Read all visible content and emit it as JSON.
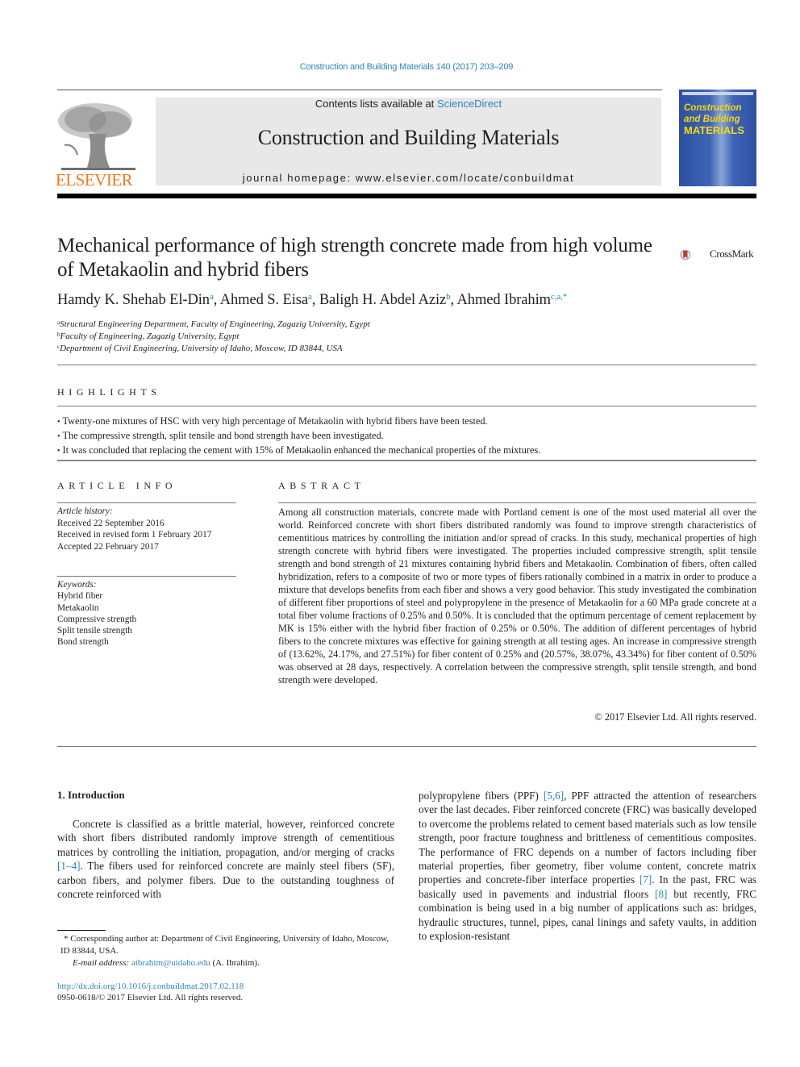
{
  "header": {
    "journal_reference": "Construction and Building Materials 140 (2017) 203–209",
    "contents_prefix": "Contents lists available at ",
    "contents_link": "ScienceDirect",
    "journal_title": "Construction and Building Materials",
    "homepage": "journal homepage: www.elsevier.com/locate/conbuildmat",
    "publisher_logo_text": "ELSEVIER",
    "cover": {
      "line1": "Construction",
      "line2": "and Building",
      "line3": "MATERIALS"
    },
    "colors": {
      "link": "#2a86b8",
      "elsevier_orange": "#f47920",
      "cover_blue": "#3f65b8",
      "cover_yellow": "#f5d90a",
      "banner_gray": "#e8e8e8"
    }
  },
  "article": {
    "title": "Mechanical performance of high strength concrete made from high volume of Metakaolin and hybrid fibers",
    "crossmark_label": "CrossMark",
    "authors": [
      {
        "name": "Hamdy K. Shehab El-Din",
        "sup": "a",
        "sep": ", "
      },
      {
        "name": "Ahmed S. Eisa",
        "sup": "a",
        "sep": ", "
      },
      {
        "name": "Baligh H. Abdel Aziz",
        "sup": "b",
        "sep": ", "
      },
      {
        "name": "Ahmed Ibrahim",
        "sup": "c,a,*",
        "sep": ""
      }
    ],
    "affiliations": [
      {
        "key": "a",
        "text": "Structural Engineering Department, Faculty of Engineering, Zagazig University, Egypt"
      },
      {
        "key": "b",
        "text": "Faculty of Engineering, Zagazig University, Egypt"
      },
      {
        "key": "c",
        "text": "Department of Civil Engineering, University of Idaho, Moscow, ID 83844, USA"
      }
    ]
  },
  "highlights": {
    "heading": "HIGHLIGHTS",
    "items": [
      "Twenty-one mixtures of HSC with very high percentage of Metakaolin with hybrid fibers have been tested.",
      "The compressive strength, split tensile and bond strength have been investigated.",
      "It was concluded that replacing the cement with 15% of Metakaolin enhanced the mechanical properties of the mixtures."
    ]
  },
  "article_info": {
    "heading": "ARTICLE INFO",
    "history_title": "Article history:",
    "history": [
      "Received 22 September 2016",
      "Received in revised form 1 February 2017",
      "Accepted 22 February 2017"
    ],
    "keywords_title": "Keywords:",
    "keywords": [
      "Hybrid fiber",
      "Metakaolin",
      "Compressive strength",
      "Split tensile strength",
      "Bond strength"
    ]
  },
  "abstract": {
    "heading": "ABSTRACT",
    "body": "Among all construction materials, concrete made with Portland cement is one of the most used material all over the world. Reinforced concrete with short fibers distributed randomly was found to improve strength characteristics of cementitious matrices by controlling the initiation and/or spread of cracks. In this study, mechanical properties of high strength concrete with hybrid fibers were investigated. The properties included compressive strength, split tensile strength and bond strength of 21 mixtures containing hybrid fibers and Metakaolin. Combination of fibers, often called hybridization, refers to a composite of two or more types of fibers rationally combined in a matrix in order to produce a mixture that develops benefits from each fiber and shows a very good behavior. This study investigated the combination of different fiber proportions of steel and polypropylene in the presence of Metakaolin for a 60 MPa grade concrete at a total fiber volume fractions of 0.25% and 0.50%. It is concluded that the optimum percentage of cement replacement by MK is 15% either with the hybrid fiber fraction of 0.25% or 0.50%. The addition of different percentages of hybrid fibers to the concrete mixtures was effective for gaining strength at all testing ages. An increase in compressive strength of (13.62%, 24.17%, and 27.51%) for fiber content of 0.25% and (20.57%, 38.07%, 43.34%) for fiber content of 0.50% was observed at 28 days, respectively. A correlation between the compressive strength, split tensile strength, and bond strength were developed.",
    "copyright": "© 2017 Elsevier Ltd. All rights reserved."
  },
  "introduction": {
    "heading": "1. Introduction",
    "left": {
      "t1": "Concrete is classified as a brittle material, however, reinforced concrete with short fibers distributed randomly improve strength of cementitious matrices by controlling the initiation, propagation, and/or merging of cracks ",
      "r1": "[1–4]",
      "t2": ". The fibers used for reinforced concrete are mainly steel fibers (SF), carbon fibers, and polymer fibers. Due to the outstanding toughness of concrete reinforced with"
    },
    "right": {
      "t1": "polypropylene fibers (PPF) ",
      "r1": "[5,6]",
      "t2": ", PPF attracted the attention of researchers over the last decades. Fiber reinforced concrete (FRC) was basically developed to overcome the problems related to cement based materials such as low tensile strength, poor fracture toughness and brittleness of cementitious composites. The performance of FRC depends on a number of factors including fiber material properties, fiber geometry, fiber volume content, concrete matrix properties and concrete-fiber interface properties ",
      "r2": "[7]",
      "t3": ". In the past, FRC was basically used in pavements and industrial floors ",
      "r3": "[8]",
      "t4": " but recently, FRC combination is being used in a big number of applications such as: bridges, hydraulic structures, tunnel, pipes, canal linings and safety vaults, in addition to explosion-resistant"
    }
  },
  "footnote": {
    "corresponding": "* Corresponding author at: Department of Civil Engineering, University of Idaho, Moscow, ID 83844, USA.",
    "email_label": "E-mail address: ",
    "email": "aibrahim@uidaho.edu",
    "email_suffix": " (A. Ibrahim).",
    "doi": "http://dx.doi.org/10.1016/j.conbuildmat.2017.02.118",
    "issn": "0950-0618/© 2017 Elsevier Ltd. All rights reserved."
  }
}
